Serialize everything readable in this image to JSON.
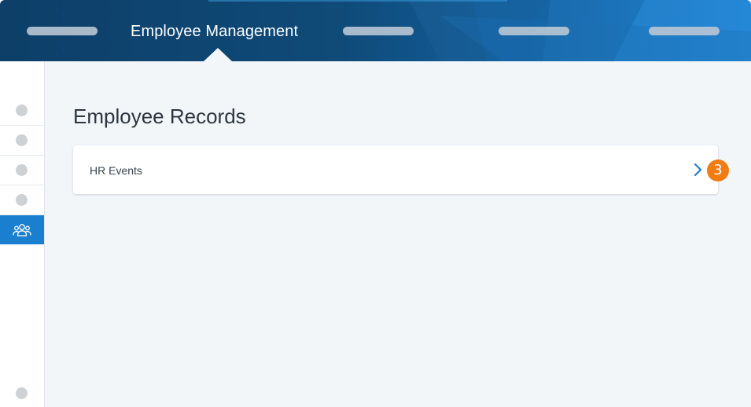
{
  "header": {
    "title": "Employee Management",
    "colors": {
      "dark": "#0d3f68",
      "light": "#1f86d6",
      "placeholder_pill": "#b9c7d4"
    },
    "nav_items": [
      {
        "type": "placeholder"
      },
      {
        "type": "label",
        "label": "Employee Management",
        "active": true
      },
      {
        "type": "placeholder"
      },
      {
        "type": "placeholder"
      },
      {
        "type": "placeholder"
      }
    ]
  },
  "sidebar": {
    "items": [
      {
        "icon": "placeholder-dot",
        "active": false
      },
      {
        "icon": "placeholder-dot",
        "active": false
      },
      {
        "icon": "placeholder-dot",
        "active": false
      },
      {
        "icon": "placeholder-dot",
        "active": false
      },
      {
        "icon": "people-icon",
        "active": true
      }
    ],
    "bottom_item": {
      "icon": "placeholder-dot"
    },
    "accent_color": "#1b7fcf"
  },
  "main": {
    "title": "Employee Records",
    "cards": [
      {
        "label": "HR Events",
        "icon": "chevron-right-icon"
      }
    ]
  },
  "callout": {
    "number": "3",
    "color": "#f07c12"
  }
}
